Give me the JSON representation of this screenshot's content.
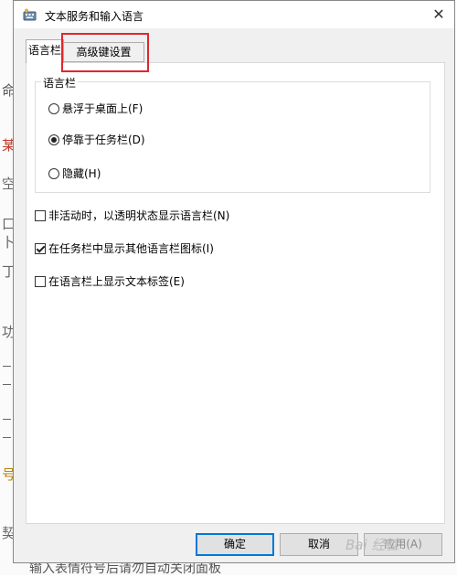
{
  "window": {
    "title": "文本服务和输入语言",
    "close_glyph": "✕"
  },
  "tabs": [
    {
      "label": "语言栏",
      "active": true
    },
    {
      "label": "高级键设置",
      "active": false
    }
  ],
  "highlight_color": "#e0262e",
  "group": {
    "title": "语言栏",
    "options": [
      {
        "label": "悬浮于桌面上(F)",
        "selected": false
      },
      {
        "label": "停靠于任务栏(D)",
        "selected": true
      },
      {
        "label": "隐藏(H)",
        "selected": false
      }
    ]
  },
  "checkboxes": [
    {
      "label": "非活动时，以透明状态显示语言栏(N)",
      "checked": false
    },
    {
      "label": "在任务栏中显示其他语言栏图标(I)",
      "checked": true
    },
    {
      "label": "在语言栏上显示文本标签(E)",
      "checked": false
    }
  ],
  "buttons": {
    "ok": "确定",
    "cancel": "取消",
    "apply": "应用(A)"
  },
  "background_fragments": {
    "chars": [
      "命",
      "某",
      "空",
      "口",
      "卜",
      "丁",
      "功",
      "号",
      "契"
    ],
    "bottom_text": "输入表情符号后请勿自动关闭面板"
  },
  "watermark": "Bai 经验"
}
